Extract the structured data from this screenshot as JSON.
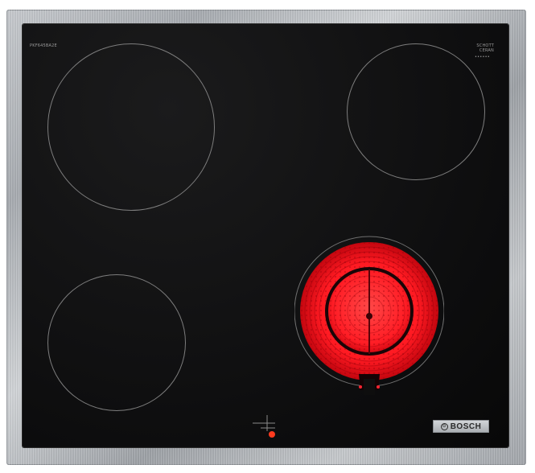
{
  "product": {
    "model_code": "PKF645BA2E",
    "glass_brand": "SCHOTT CERAN",
    "glass_sub": "••••••",
    "brand_name": "BOSCH"
  },
  "colors": {
    "glass": "#0d0d0e",
    "zone_outline": "#7d7d7d",
    "heating_glow": "#ff1a22",
    "indicator": "#ff3b1f",
    "frame": "#b7bbc0"
  },
  "icons": {
    "brand_logo": "bosch-armature-icon",
    "control_mark": "crosshair-control-icon"
  }
}
